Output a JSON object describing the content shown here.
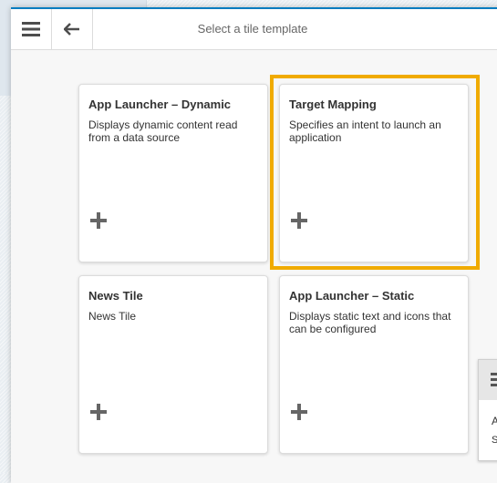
{
  "header": {
    "title": "Select a tile template"
  },
  "tiles": [
    {
      "title": "App Launcher – Dynamic",
      "description": "Displays dynamic content read from a data source"
    },
    {
      "title": "Target Mapping",
      "description": "Specifies an intent to launch an application"
    },
    {
      "title": "News Tile",
      "description": "News Tile"
    },
    {
      "title": "App Launcher – Static",
      "description": "Displays static text and icons that can be configured"
    }
  ],
  "highlight_color": "#f0ab00",
  "accent_color": "#007cc0",
  "peek_card": {
    "line1": "A",
    "line2": "S"
  }
}
